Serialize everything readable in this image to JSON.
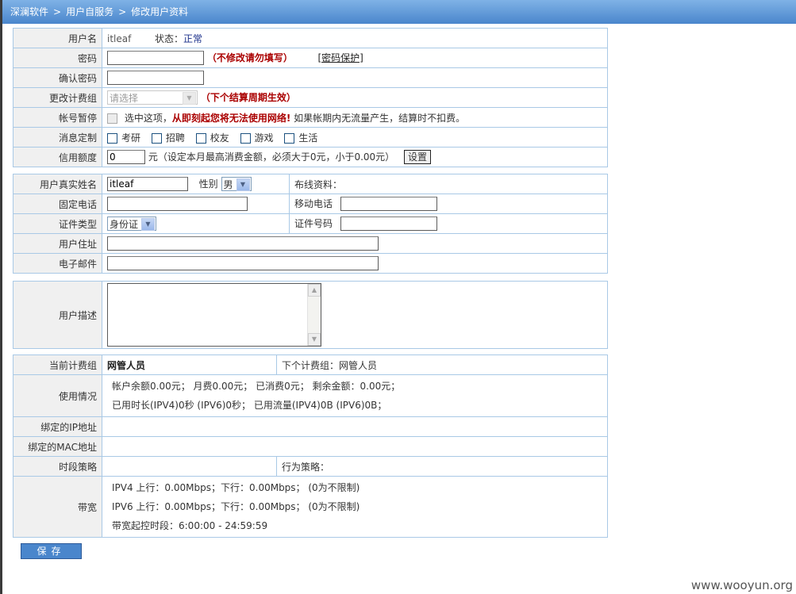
{
  "breadcrumb": [
    "深澜软件",
    "用户自服务",
    "修改用户资料"
  ],
  "breadcrumb_sep": ">",
  "basic": {
    "username_label": "用户名",
    "username_value": "itleaf",
    "status_label": "状态：",
    "status_value": "正常",
    "password_label": "密码",
    "password_hint": "（不修改请勿填写）",
    "password_protect_link": "[密码保护]",
    "confirm_label": "确认密码",
    "group_label": "更改计费组",
    "group_select_value": "请选择",
    "group_hint": "（下个结算周期生效）",
    "suspend_label": "帐号暂停",
    "suspend_text_1": "选中这项，",
    "suspend_text_red": "从即刻起您将无法使用网络!",
    "suspend_text_2": "如果帐期内无流量产生，结算时不扣费。",
    "msg_label": "消息定制",
    "msg_options": [
      "考研",
      "招聘",
      "校友",
      "游戏",
      "生活"
    ],
    "credit_label": "信用额度",
    "credit_value": "0",
    "credit_hint": "元（设定本月最高消费金额，必须大于0元，小于0.00元）",
    "credit_button": "设置"
  },
  "personal": {
    "realname_label": "用户真实姓名",
    "realname_value": "itleaf",
    "gender_label": "性别",
    "gender_value": "男",
    "wiring_label": "布线资料：",
    "phone_label": "固定电话",
    "mobile_label": "移动电话",
    "idtype_label": "证件类型",
    "idtype_value": "身份证",
    "idnum_label": "证件号码",
    "address_label": "用户住址",
    "email_label": "电子邮件"
  },
  "description": {
    "label": "用户描述"
  },
  "billing": {
    "current_group_label": "当前计费组",
    "current_group_value": "网管人员",
    "next_group_text": "下个计费组：网管人员",
    "usage_label": "使用情况",
    "usage_line_1": "帐户余额0.00元；  月费0.00元；  已消费0元；  剩余金额：0.00元；",
    "usage_line_2": "已用时长(IPV4)0秒 (IPV6)0秒；  已用流量(IPV4)0B (IPV6)0B；",
    "ip_label": "绑定的IP地址",
    "mac_label": "绑定的MAC地址",
    "time_policy_label": "时段策略",
    "behavior_policy_text": "行为策略：",
    "bandwidth_label": "带宽",
    "bandwidth_line_1": "IPV4 上行：0.00Mbps；下行：0.00Mbps；  (0为不限制)",
    "bandwidth_line_2": "IPV6 上行：0.00Mbps；下行：0.00Mbps；  (0为不限制)",
    "bandwidth_line_3": "带宽起控时段：6:00:00 - 24:59:59"
  },
  "save_button": "保存",
  "watermark": "www.wooyun.org"
}
